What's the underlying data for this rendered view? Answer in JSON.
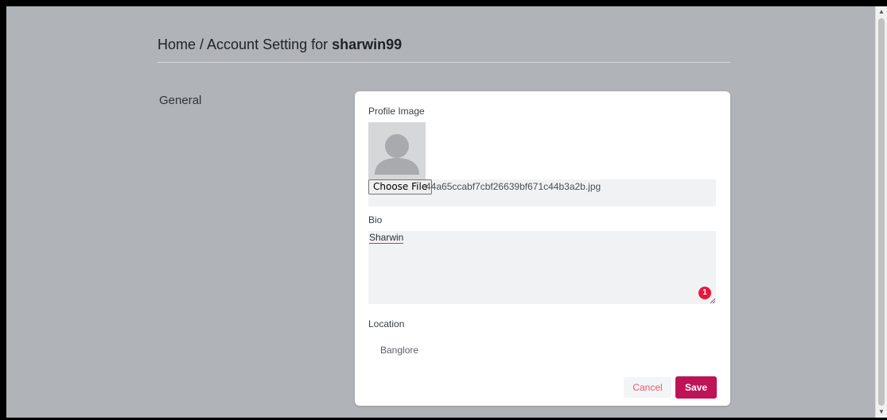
{
  "breadcrumb": {
    "path": "Home / Account Setting for ",
    "username": "sharwin99"
  },
  "sidebar": {
    "section_label": "General"
  },
  "form": {
    "profile_image_label": "Profile Image",
    "avatar_icon": "user-silhouette-icon",
    "choose_file_label": "Choose File",
    "file_name": "44a65ccabf7cbf26639bf671c44b3a2b.jpg",
    "bio_label": "Bio",
    "bio_value": "Sharwin",
    "grammar_count": "1",
    "location_label": "Location",
    "location_value": "Banglore",
    "cancel_label": "Cancel",
    "save_label": "Save"
  },
  "colors": {
    "backdrop": "#b0b3b7",
    "save_button": "#be1457",
    "cancel_text": "#e35a70",
    "grammar_badge": "#e5193c"
  }
}
